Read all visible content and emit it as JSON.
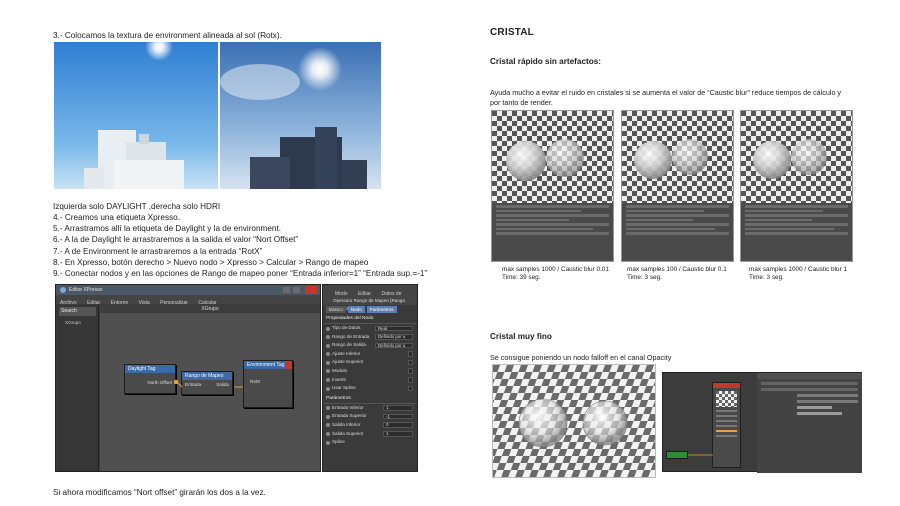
{
  "left": {
    "step3": "3.- Colocamos la textura de environment alineada al sol (Rotx).",
    "caption_compare": "Izquierda solo DAYLIGHT ,derecha solo HDRI",
    "steps": [
      "4.- Creamos una etiqueta Xpresso.",
      "5.- Arrastramos allí la etiqueta de Daylight y la de environment.",
      "6.- A la de Daylight le arrastraremos a la salida el valor “Nort Offset”",
      "7.- A de Environment le arrastraremos a la entrada “RotX”",
      "8.- En Xpresso, botón derecho > Nuevo nodo > Xpresso > Calcular > Rango de mapeo",
      "9.- Conectar nodos y en las opciones de Rango de mapeo poner “Entrada inferior=1” “Entrada sup.=-1”"
    ],
    "footer": "Si ahora modificamos “Nort offset” girarán los dos a la vez."
  },
  "xpresso": {
    "window_title": "Editor XPresso",
    "menu": [
      "Archivo",
      "Editar",
      "Entorno",
      "Vista",
      "Personalizar",
      "Calcular"
    ],
    "tab_label": "XGrupo",
    "search_label": "Search",
    "tree_item": "XGrupo",
    "nodes": {
      "daylight": {
        "title": "Daylight Tag",
        "port": "North Offset"
      },
      "range": {
        "title": "Rango de Mapeo",
        "in": "Entrada",
        "out": "Salida"
      },
      "environment": {
        "title": "Environment Tag",
        "port": "RotX"
      }
    },
    "attr_menu": [
      "Modo",
      "Editar",
      "Datos de Usuario"
    ],
    "attr_title": "Operador Rango de Mapeo [Rango",
    "attr_tabs": [
      "Básico",
      "Nodo",
      "Parámetros"
    ],
    "section1": "Propiedades del Nodo",
    "props1": [
      {
        "label": "Tipo de Datos",
        "value": "Real"
      },
      {
        "label": "Rango de Entrada",
        "value": "Definido por u"
      },
      {
        "label": "Rango de Salida",
        "value": "Definido por u"
      },
      {
        "label": "Ajuste Inferior",
        "value": ""
      },
      {
        "label": "Ajuste Superior",
        "value": ""
      },
      {
        "label": "Modulo",
        "value": ""
      },
      {
        "label": "Invertir",
        "value": ""
      },
      {
        "label": "Usar Spline",
        "value": ""
      }
    ],
    "section2": "Parámetros",
    "props2": [
      {
        "label": "Entrada Inferior",
        "value": "1"
      },
      {
        "label": "Entrada Superior",
        "value": "-1"
      },
      {
        "label": "Salida Inferior",
        "value": "0"
      },
      {
        "label": "Salida Superior",
        "value": "1"
      },
      {
        "label": "Spline",
        "value": ""
      }
    ]
  },
  "right": {
    "title": "CRISTAL",
    "sub1": "Cristal rápido sin artefactos:",
    "para1": "Ayuda mucho a evitar el ruido en cristales si se aumenta el valor de “Caustic blur” reduce tiempos de cálculo y por tanto de render.",
    "renders": [
      {
        "line1": "max samples 1000 / Caustic blur 0.01",
        "line2": "Time: 39 seg."
      },
      {
        "line1": "max samples 100 / Caustic blur 0.1",
        "line2": "Time: 3 seg."
      },
      {
        "line1": "max samples 1000 / Caustic blur 1",
        "line2": "Time: 3 seg."
      }
    ],
    "sub2": "Cristal muy fino",
    "para2": "Se consigue poniendo un nodo falloff en el canal Opacity"
  }
}
